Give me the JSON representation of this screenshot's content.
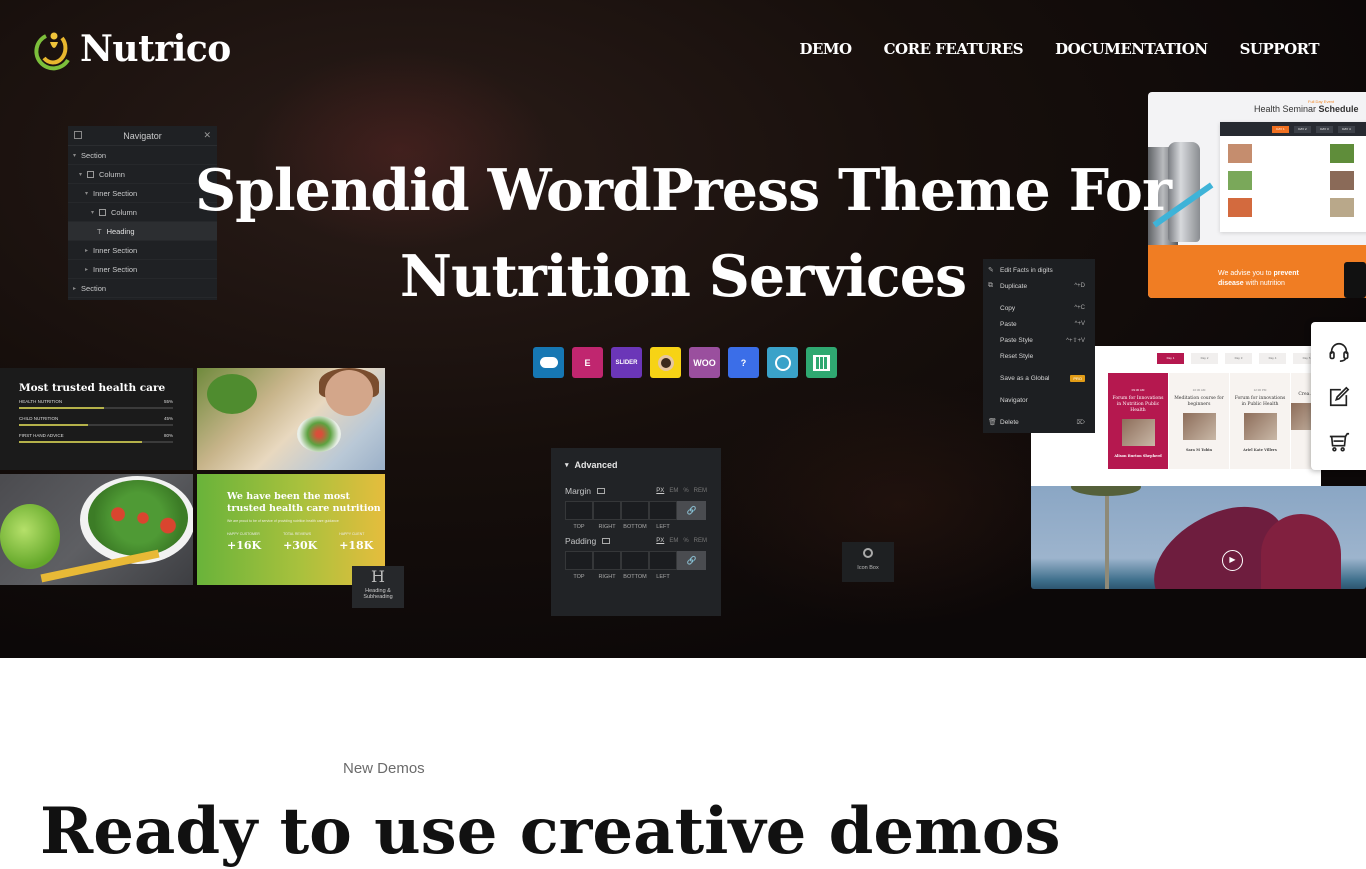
{
  "header": {
    "logo_text": "Nutrico",
    "nav": [
      "DEMO",
      "CORE FEATURES",
      "DOCUMENTATION",
      "SUPPORT"
    ]
  },
  "hero": {
    "title_line1": "Splendid WordPress Theme For",
    "title_line2": "Nutrition Services",
    "plugins": [
      {
        "name": "cloud-plugin-icon",
        "label": "",
        "color": "#1677b3"
      },
      {
        "name": "elementor-icon",
        "label": "E",
        "color": "#c0266f"
      },
      {
        "name": "slider-revolution-icon",
        "label": "SLIDER",
        "color": "#6b36b8"
      },
      {
        "name": "mailchimp-icon",
        "label": "",
        "color": "#f7d315"
      },
      {
        "name": "woocommerce-icon",
        "label": "WOO",
        "color": "#9a4f9e"
      },
      {
        "name": "question-plugin-icon",
        "label": "?",
        "color": "#3b6ee8"
      },
      {
        "name": "chat-plugin-icon",
        "label": "",
        "color": "#3aa2c9"
      },
      {
        "name": "calendar-plugin-icon",
        "label": "",
        "color": "#2fa871"
      }
    ]
  },
  "navigator_panel": {
    "title": "Navigator",
    "rows": [
      {
        "label": "Section",
        "level": 0,
        "caret": "▾",
        "icon": false,
        "active": false
      },
      {
        "label": "Column",
        "level": 1,
        "caret": "▾",
        "icon": true,
        "active": false
      },
      {
        "label": "Inner Section",
        "level": 2,
        "caret": "▾",
        "icon": false,
        "active": false
      },
      {
        "label": "Column",
        "level": 3,
        "caret": "▾",
        "icon": true,
        "active": false
      },
      {
        "label": "Heading",
        "level": 4,
        "caret": "",
        "icon": false,
        "active": true,
        "glyph": "T"
      },
      {
        "label": "Inner Section",
        "level": 2,
        "caret": "▸",
        "icon": false,
        "active": false
      },
      {
        "label": "Inner Section",
        "level": 2,
        "caret": "▸",
        "icon": false,
        "active": false
      },
      {
        "label": "Section",
        "level": 0,
        "caret": "▸",
        "icon": false,
        "active": false
      }
    ]
  },
  "trusted_card": {
    "title": "Most trusted health care",
    "bars": [
      {
        "label": "HEALTH NUTRITION",
        "value": "55%",
        "fraction": 0.55
      },
      {
        "label": "CHILD NUTRITION",
        "value": "45%",
        "fraction": 0.45
      },
      {
        "label": "FIRST HAND ADVICE",
        "value": "80%",
        "fraction": 0.8
      }
    ]
  },
  "green_card": {
    "title_line1": "We have been the most",
    "title_line2": "trusted health care nutrition",
    "body": "We are proud to be of service of providing nutrition health care guidance",
    "stats": [
      {
        "label": "HAPPY CUSTOMER",
        "value": "+16K"
      },
      {
        "label": "TOTAL REVIEWS",
        "value": "+30K"
      },
      {
        "label": "HAPPY CLIENT",
        "value": "+18K"
      }
    ]
  },
  "widget_heading": {
    "glyph": "H",
    "label_line1": "Heading &",
    "label_line2": "Subheading"
  },
  "widget_iconbox": {
    "label": "Icon Box"
  },
  "advanced_panel": {
    "title": "Advanced",
    "margin_label": "Margin",
    "padding_label": "Padding",
    "units": [
      "PX",
      "EM",
      "%",
      "REM"
    ],
    "captions": [
      "TOP",
      "RIGHT",
      "BOTTOM",
      "LEFT"
    ]
  },
  "context_menu": {
    "items": [
      {
        "icon": "pencil-icon",
        "glyph": "✎",
        "label": "Edit Facts in digits",
        "shortcut": ""
      },
      {
        "icon": "duplicate-icon",
        "glyph": "⧉",
        "label": "Duplicate",
        "shortcut": "^+D"
      },
      {
        "sep": true
      },
      {
        "icon": "",
        "glyph": "",
        "label": "Copy",
        "shortcut": "^+C"
      },
      {
        "icon": "",
        "glyph": "",
        "label": "Paste",
        "shortcut": "^+V"
      },
      {
        "icon": "",
        "glyph": "",
        "label": "Paste Style",
        "shortcut": "^+⇧+V"
      },
      {
        "icon": "",
        "glyph": "",
        "label": "Reset Style",
        "shortcut": ""
      },
      {
        "sep": true
      },
      {
        "icon": "",
        "glyph": "",
        "label": "Save as a Global",
        "shortcut": "",
        "badge": "PRO"
      },
      {
        "sep": true
      },
      {
        "icon": "",
        "glyph": "",
        "label": "Navigator",
        "shortcut": ""
      },
      {
        "sep": true
      },
      {
        "icon": "trash-icon",
        "glyph": "🗑",
        "label": "Delete",
        "shortcut": "⌦"
      }
    ]
  },
  "schedule_mock": {
    "subtitle": "Full Day Event",
    "title_plain": "Health Seminar ",
    "title_bold": "Schedule",
    "tabs": [
      "DAY 1",
      "DAY 2",
      "DAY 3",
      "DAY 4"
    ],
    "promo_plain1": "We advise you to ",
    "promo_bold1": "prevent",
    "promo_bold2": "disease",
    "promo_plain2": " with nutrition"
  },
  "events_mock": {
    "tabs": [
      "Day 1",
      "Day 2",
      "Day 3",
      "Day 4",
      "Day 5"
    ],
    "cards": [
      {
        "time": "09:30 AM",
        "title": "Forum for Innovations in Nutrition Public Health",
        "speaker": "Alison Burton Shepherd",
        "active": true
      },
      {
        "time": "10:30 AM",
        "title": "Meditation course for beginners",
        "speaker": "Sara M Tobin",
        "active": false
      },
      {
        "time": "12:30 PM",
        "title": "Forum for innovations in Public Health",
        "speaker": "Ariel Kate Villers",
        "active": false
      },
      {
        "time": "",
        "title": "Crea...",
        "speaker": "",
        "active": false
      }
    ]
  },
  "floating_sidebar": {
    "items": [
      "headset-icon",
      "edit-icon",
      "cart-icon"
    ]
  },
  "section": {
    "eyebrow": "New Demos",
    "heading": "Ready to use creative demos"
  }
}
